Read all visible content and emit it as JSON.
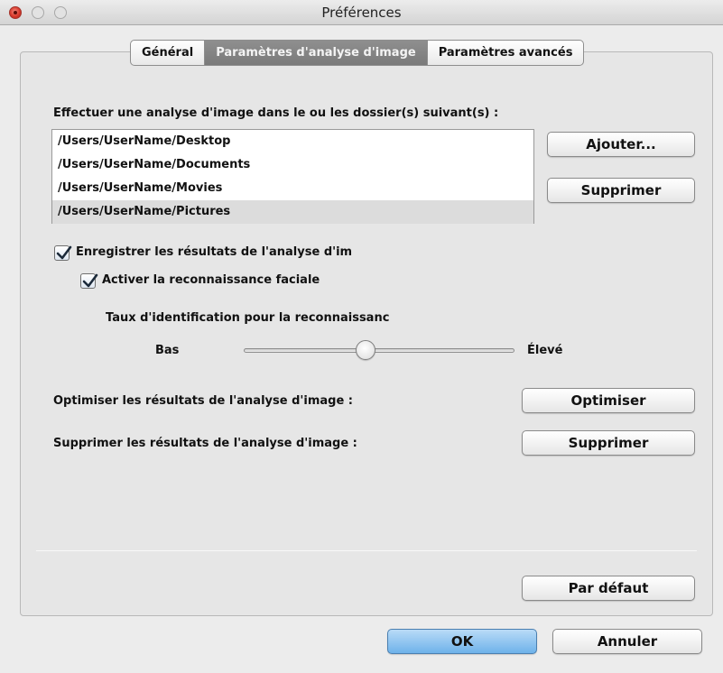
{
  "window": {
    "title": "Préférences"
  },
  "tabs": [
    {
      "label": "Général",
      "active": false
    },
    {
      "label": "Paramètres d'analyse d'image",
      "active": true
    },
    {
      "label": "Paramètres avancés",
      "active": false
    }
  ],
  "folders": {
    "label": "Effectuer une analyse d'image dans le ou les dossier(s) suivant(s) :",
    "items": [
      "/Users/UserName/Desktop",
      "/Users/UserName/Documents",
      "/Users/UserName/Movies",
      "/Users/UserName/Pictures"
    ],
    "selected_index": 3,
    "add_label": "Ajouter...",
    "remove_label": "Supprimer"
  },
  "options": {
    "save_results": {
      "label": "Enregistrer les résultats de l'analyse d'im",
      "checked": true
    },
    "face_recognition": {
      "label": "Activer la reconnaissance faciale",
      "checked": true
    }
  },
  "recognition_rate": {
    "label": "Taux d'identification pour la reconnaissanc",
    "low_label": "Bas",
    "high_label": "Élevé",
    "value_fraction": 0.45
  },
  "optimize": {
    "label": "Optimiser les résultats de l'analyse d'image :",
    "button": "Optimiser"
  },
  "delete": {
    "label": "Supprimer les résultats de l'analyse d'image :",
    "button": "Supprimer"
  },
  "defaults_button": "Par défaut",
  "footer": {
    "ok_label": "OK",
    "cancel_label": "Annuler"
  }
}
